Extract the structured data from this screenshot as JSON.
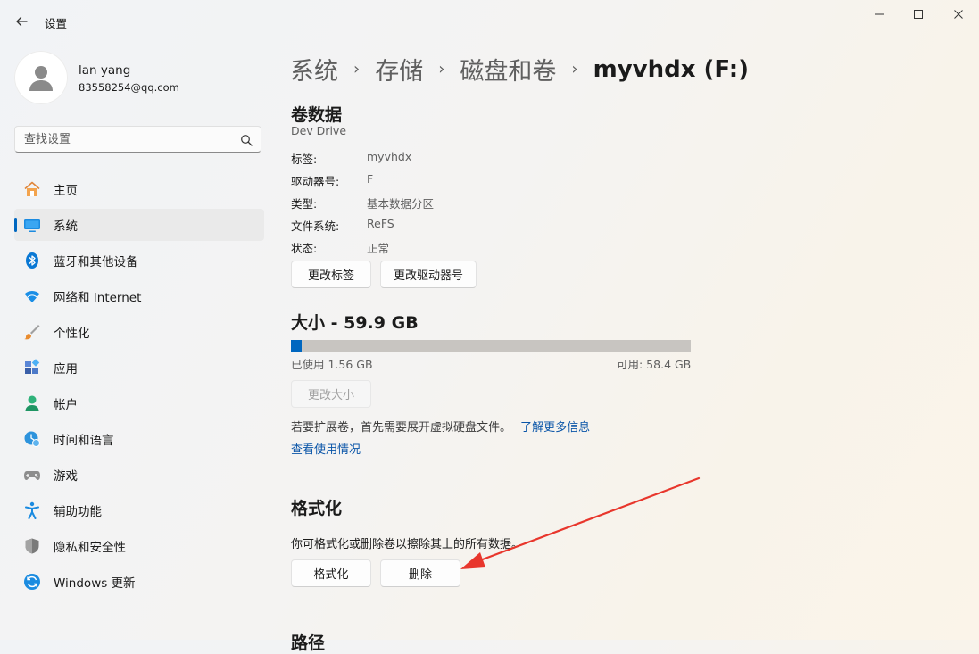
{
  "app": {
    "title": "设置"
  },
  "profile": {
    "name": "lan yang",
    "email": "83558254@qq.com"
  },
  "search": {
    "placeholder": "查找设置"
  },
  "nav": [
    {
      "label": "主页",
      "icon": "home-icon"
    },
    {
      "label": "系统",
      "icon": "system-icon",
      "active": true
    },
    {
      "label": "蓝牙和其他设备",
      "icon": "bluetooth-icon"
    },
    {
      "label": "网络和 Internet",
      "icon": "wifi-icon"
    },
    {
      "label": "个性化",
      "icon": "brush-icon"
    },
    {
      "label": "应用",
      "icon": "apps-icon"
    },
    {
      "label": "帐户",
      "icon": "account-icon"
    },
    {
      "label": "时间和语言",
      "icon": "time-language-icon"
    },
    {
      "label": "游戏",
      "icon": "gamepad-icon"
    },
    {
      "label": "辅助功能",
      "icon": "accessibility-icon"
    },
    {
      "label": "隐私和安全性",
      "icon": "shield-icon"
    },
    {
      "label": "Windows 更新",
      "icon": "update-icon"
    }
  ],
  "breadcrumb": {
    "items": [
      "系统",
      "存储",
      "磁盘和卷"
    ],
    "current": "myvhdx (F:)",
    "separator": "›"
  },
  "volume": {
    "heading": "卷数据",
    "subtitle": "Dev Drive",
    "props": [
      {
        "label": "标签:",
        "value": "myvhdx"
      },
      {
        "label": "驱动器号:",
        "value": "F"
      },
      {
        "label": "类型:",
        "value": "基本数据分区"
      },
      {
        "label": "文件系统:",
        "value": "ReFS"
      },
      {
        "label": "状态:",
        "value": "正常"
      }
    ],
    "change_label_button": "更改标签",
    "change_letter_button": "更改驱动器号"
  },
  "size": {
    "heading": "大小 - 59.9 GB",
    "used_label": "已使用 1.56 GB",
    "free_label": "可用: 58.4 GB",
    "used_fraction": 0.026,
    "resize_button": "更改大小",
    "note": "若要扩展卷，首先需要展开虚拟硬盘文件。",
    "learn_more": "了解更多信息",
    "view_usage": "查看使用情况"
  },
  "format": {
    "heading": "格式化",
    "description": "你可格式化或删除卷以擦除其上的所有数据。",
    "format_button": "格式化",
    "delete_button": "删除"
  },
  "path": {
    "heading": "路径"
  },
  "colors": {
    "accent": "#0067c0",
    "annotation_arrow": "#e8362c"
  }
}
